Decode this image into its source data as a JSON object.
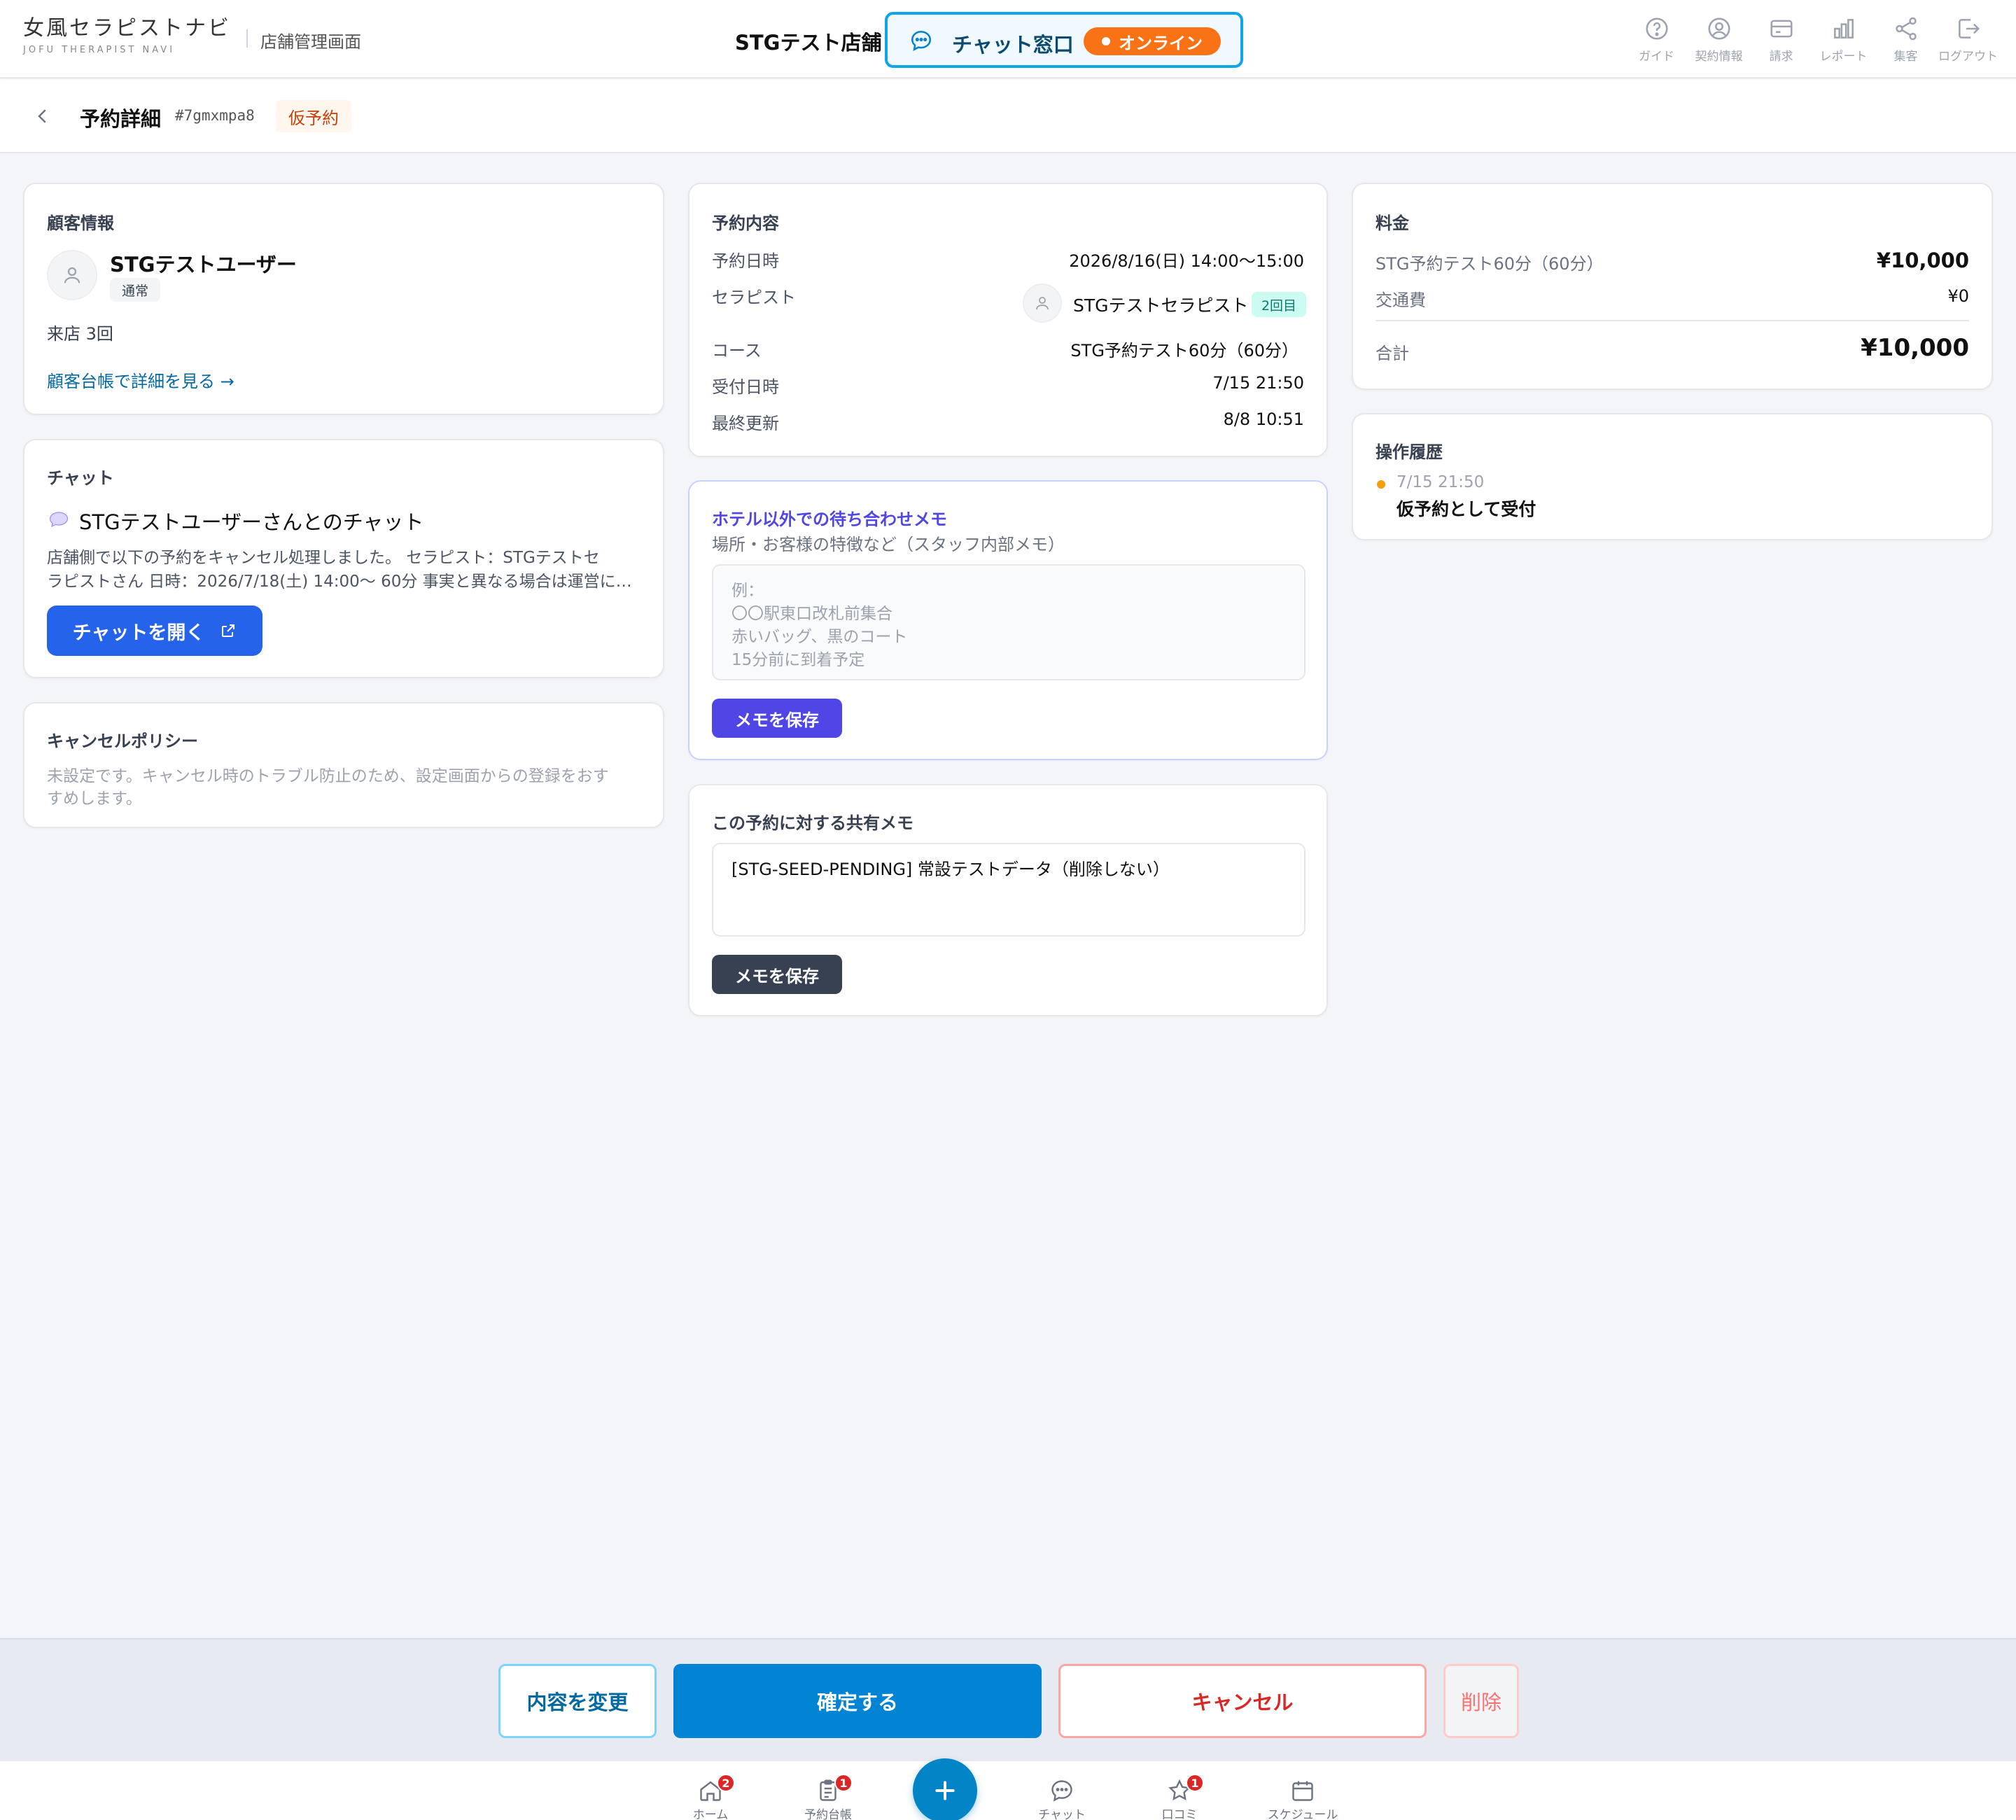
{
  "header": {
    "logo_main": "女風セラピストナビ",
    "logo_sub": "JOFU THERAPIST NAVI",
    "logo_tag": "店舗管理画面",
    "shop_name": "STGテスト店舗",
    "chat_window_label": "チャット窓口",
    "online_label": "オンライン",
    "nav": [
      {
        "label": "ガイド",
        "icon": "help-circle-icon"
      },
      {
        "label": "契約情報",
        "icon": "user-circle-icon"
      },
      {
        "label": "請求",
        "icon": "credit-card-icon"
      },
      {
        "label": "レポート",
        "icon": "bar-chart-icon"
      },
      {
        "label": "集客",
        "icon": "share-icon"
      },
      {
        "label": "ログアウト",
        "icon": "logout-icon"
      }
    ]
  },
  "subheader": {
    "title": "予約詳細",
    "code": "#7gmxmpa8",
    "badge": "仮予約"
  },
  "customer": {
    "title": "顧客情報",
    "name": "STGテストユーザー",
    "tag": "通常",
    "visits": "来店 3回",
    "link": "顧客台帳で詳細を見る →"
  },
  "chat": {
    "title": "チャット",
    "thread_title": "STGテストユーザーさんとのチャット",
    "preview_line1": "店舗側で以下の予約をキャンセル処理しました。 セラピスト：STGテストセ",
    "preview_line2": "ラピストさん 日時：2026/7/18(土) 14:00〜 60分 事実と異なる場合は運営に…",
    "open_button": "チャットを開く"
  },
  "cancel_policy": {
    "title": "キャンセルポリシー",
    "line1": "未設定です。キャンセル時のトラブル防止のため、設定画面からの登録をおす",
    "line2": "すめします。"
  },
  "reservation": {
    "title": "予約内容",
    "datetime_label": "予約日時",
    "datetime_value": "2026/8/16(日) 14:00〜15:00",
    "therapist_label": "セラピスト",
    "therapist_name": "STGテストセラピスト",
    "therapist_badge": "2回目",
    "course_label": "コース",
    "course_value": "STG予約テスト60分（60分）",
    "received_label": "受付日時",
    "received_value": "7/15 21:50",
    "updated_label": "最終更新",
    "updated_value": "8/8 10:51"
  },
  "meeting_memo": {
    "title": "ホテル以外での待ち合わせメモ",
    "subtitle": "場所・お客様の特徴など（スタッフ内部メモ）",
    "placeholder_lines": [
      "例：",
      "〇〇駅東口改札前集合",
      "赤いバッグ、黒のコート",
      "15分前に到着予定"
    ],
    "save_button": "メモを保存"
  },
  "shared_memo": {
    "title": "この予約に対する共有メモ",
    "value": "[STG-SEED-PENDING] 常設テストデータ（削除しない）",
    "save_button": "メモを保存"
  },
  "price": {
    "title": "料金",
    "course_label": "STG予約テスト60分（60分）",
    "course_value": "¥10,000",
    "transport_label": "交通費",
    "transport_value": "¥0",
    "total_label": "合計",
    "total_value": "¥10,000"
  },
  "history": {
    "title": "操作履歴",
    "items": [
      {
        "time": "7/15 21:50",
        "text": "仮予約として受付"
      }
    ]
  },
  "actions": {
    "edit": "内容を変更",
    "confirm": "確定する",
    "cancel": "キャンセル",
    "delete": "削除"
  },
  "bottom_nav": {
    "home": {
      "label": "ホーム",
      "badge": "2"
    },
    "ledger": {
      "label": "予約台帳",
      "badge": "1"
    },
    "chat": {
      "label": "チャット"
    },
    "reviews": {
      "label": "口コミ",
      "badge": "1"
    },
    "schedule": {
      "label": "スケジュール"
    }
  },
  "colors": {
    "primary": "#0284c7",
    "confirm": "#0283d3",
    "danger": "#dc2626",
    "online": "#f97316",
    "memo_purple": "#4f46e5"
  }
}
